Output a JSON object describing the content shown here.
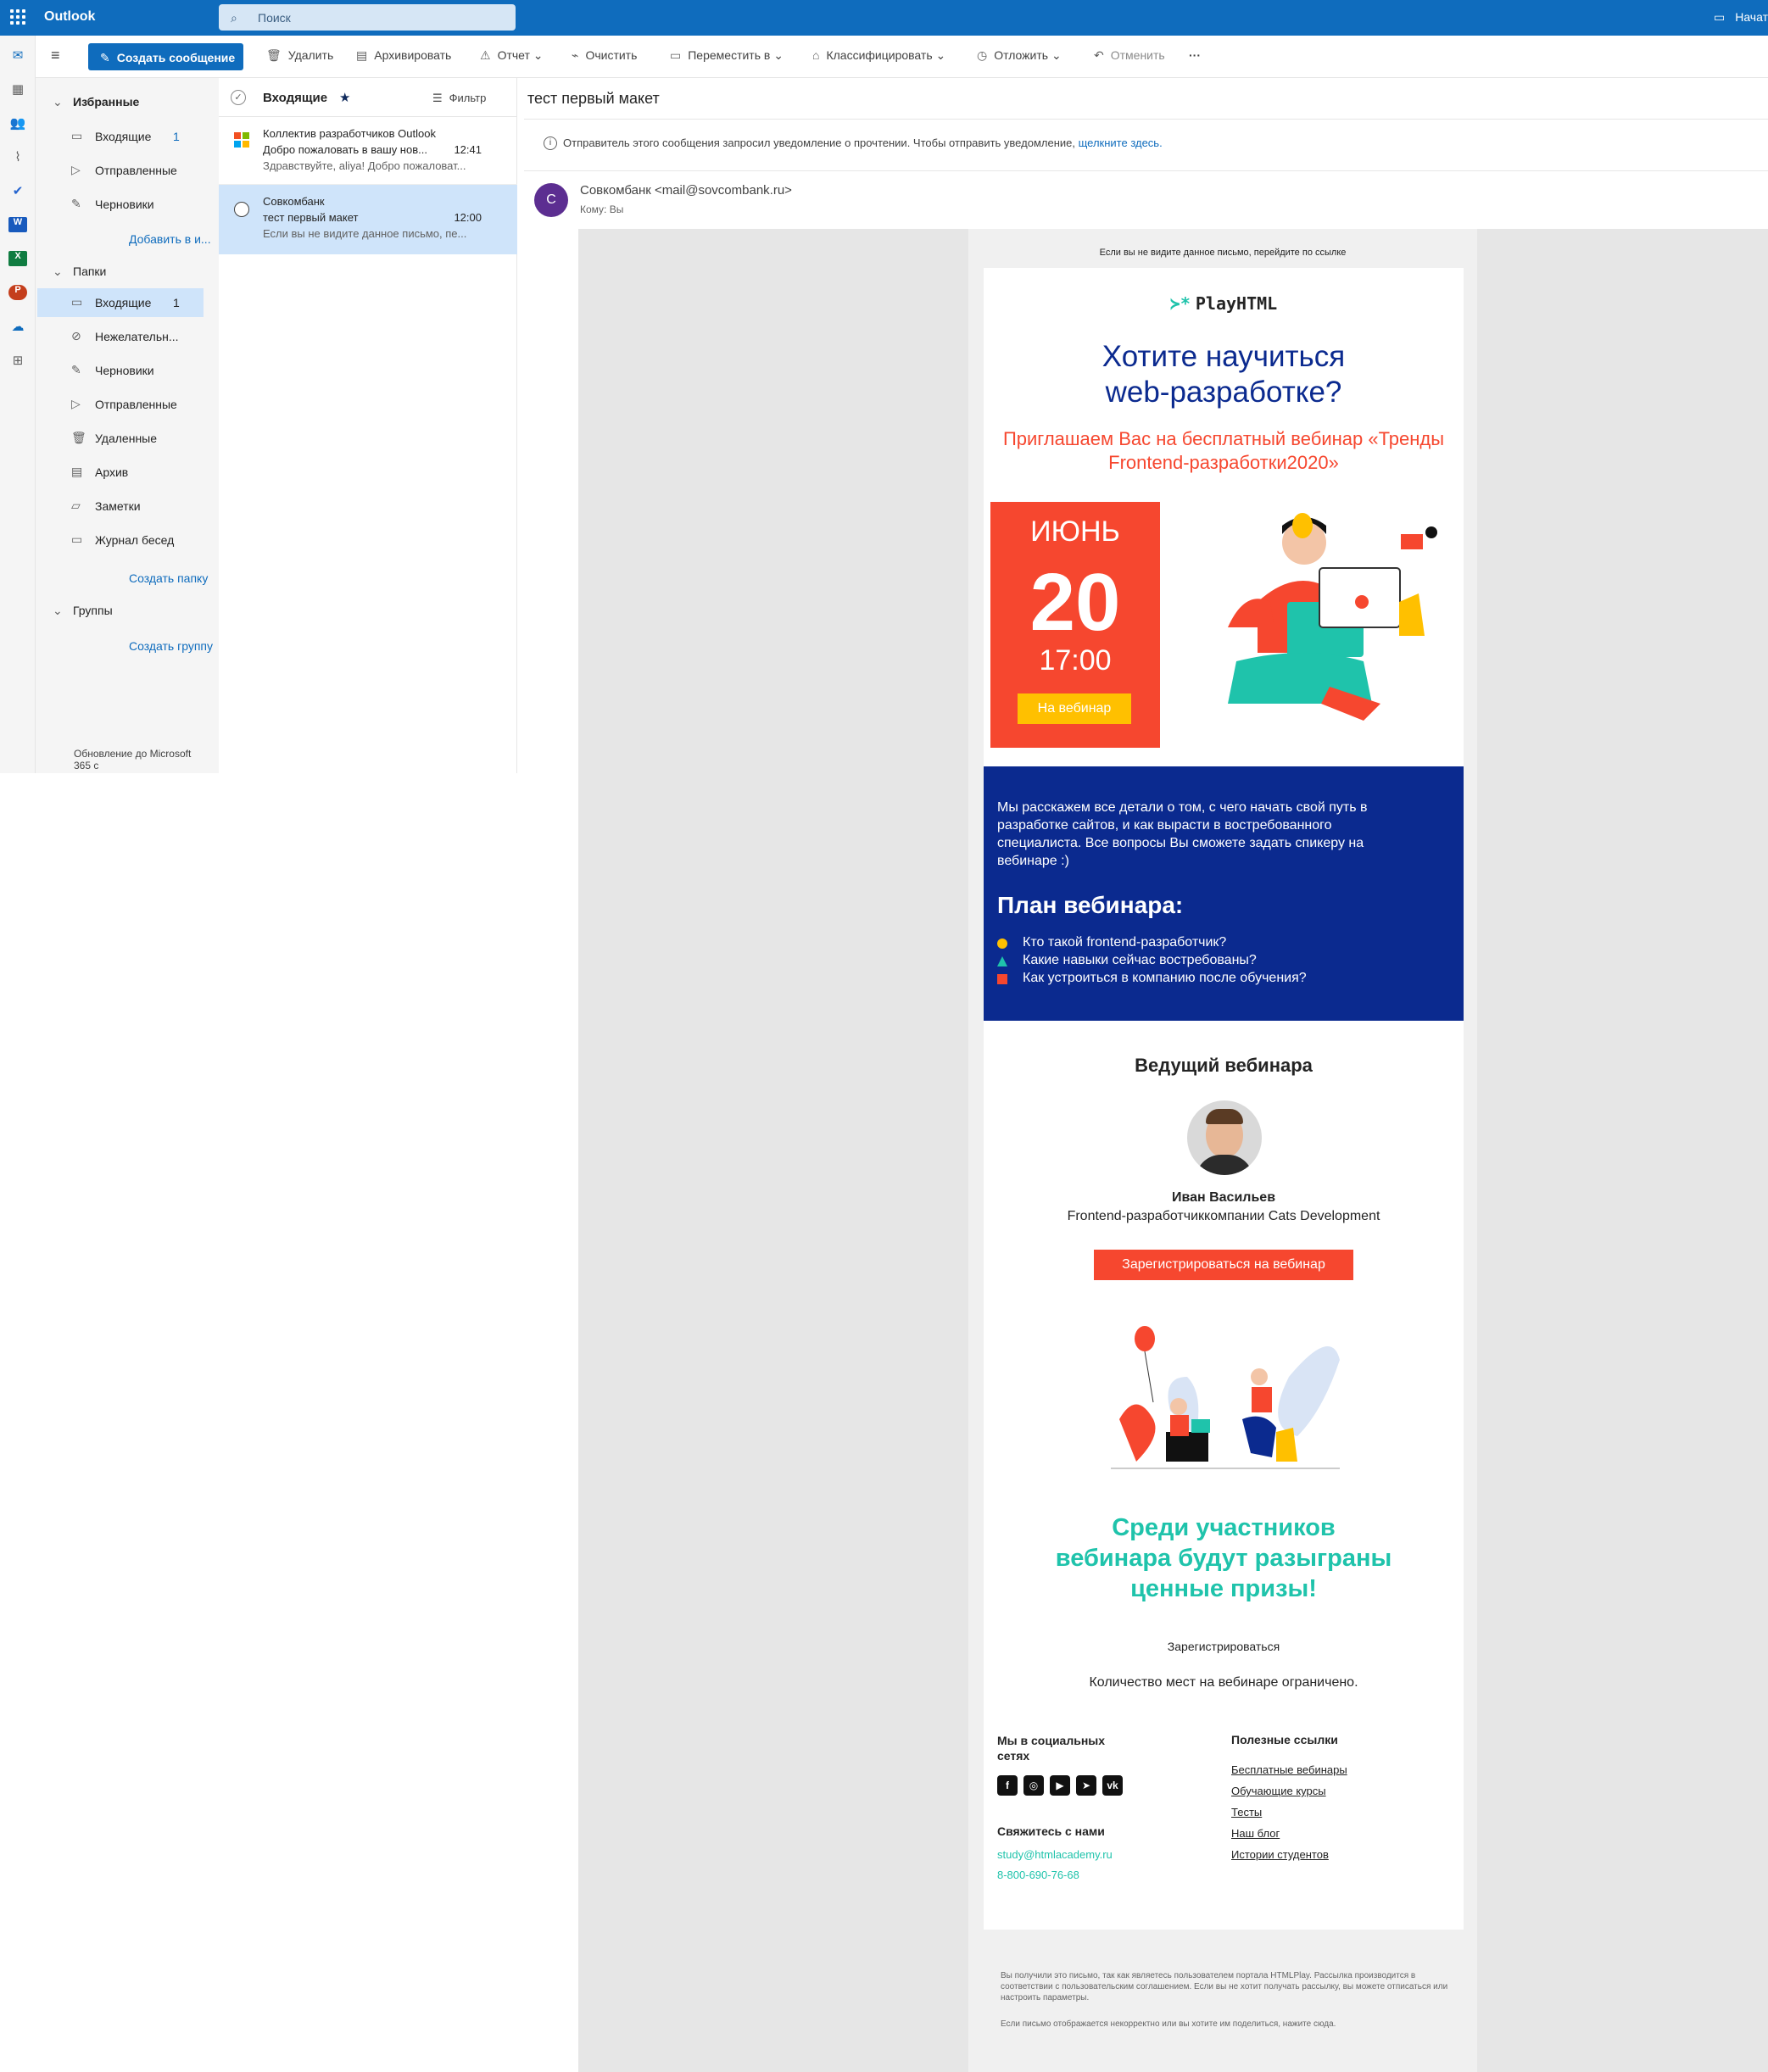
{
  "app": {
    "brand": "Outlook",
    "search_placeholder": "Поиск",
    "top_right": "Начат"
  },
  "toolbar": {
    "new_message": "Создать сообщение",
    "delete": "Удалить",
    "archive": "Архивировать",
    "report": "Отчет",
    "sweep": "Очистить",
    "move_to": "Переместить в",
    "categorize": "Классифицировать",
    "snooze": "Отложить",
    "undo": "Отменить",
    "more": "···"
  },
  "folders": {
    "favorites_header": "Избранные",
    "favorites": [
      {
        "label": "Входящие",
        "count": "1"
      },
      {
        "label": "Отправленные",
        "count": ""
      },
      {
        "label": "Черновики",
        "count": ""
      }
    ],
    "add_favorite": "Добавить в и...",
    "folders_header": "Папки",
    "items": [
      {
        "label": "Входящие",
        "count": "1"
      },
      {
        "label": "Нежелательн...",
        "count": ""
      },
      {
        "label": "Черновики",
        "count": ""
      },
      {
        "label": "Отправленные",
        "count": ""
      },
      {
        "label": "Удаленные",
        "count": ""
      },
      {
        "label": "Архив",
        "count": ""
      },
      {
        "label": "Заметки",
        "count": ""
      },
      {
        "label": "Журнал бесед",
        "count": ""
      }
    ],
    "create_folder": "Создать папку",
    "groups_header": "Группы",
    "create_group": "Создать группу",
    "upgrade": "Обновление до Microsoft 365 с"
  },
  "message_list": {
    "header": "Входящие",
    "filter": "Фильтр",
    "items": [
      {
        "sender": "Коллектив разработчиков Outlook",
        "subject": "Добро пожаловать в вашу нов...",
        "time": "12:41",
        "preview": "Здравствуйте, aliya! Добро пожаловат..."
      },
      {
        "sender": "Совкомбанк",
        "subject": "тест первый макет",
        "time": "12:00",
        "preview": "Если вы не видите данное письмо, пе..."
      }
    ]
  },
  "reading": {
    "subject": "тест первый макет",
    "notice": "Отправитель этого сообщения запросил уведомление о прочтении. Чтобы отправить уведомление,",
    "notice_link": "щелкните здесь.",
    "avatar_letter": "C",
    "sender": "Совкомбанк <mail@sovcombank.ru>",
    "to_label": "Кому:",
    "to_value": "Вы"
  },
  "email": {
    "preheader": "Если вы не видите данное письмо, перейдите по  ссылке",
    "logo": "PlayHTML",
    "headline": "Хотите научиться web-разработке?",
    "invite": "Приглашаем Вас на бесплатный вебинар «Тренды Frontend-разработки2020»",
    "month": "ИЮНЬ",
    "day": "20",
    "time": "17:00",
    "webinar_button": "На вебинар",
    "intro": "Мы расскажем все детали о том, с чего начать свой путь в разработке сайтов, и как вырасти в востребованного специалиста. Все вопросы Вы сможете задать спикеру на вебинаре :)",
    "plan_title": "План вебинара:",
    "plan": [
      "Кто такой frontend-разработчик?",
      "Какие навыки сейчас востребованы?",
      "Как устроиться в компанию после обучения?"
    ],
    "host_title": "Ведущий вебинара",
    "host_name": "Иван Васильев",
    "host_role": "Frontend-разработчиккомпании Cats Development",
    "register_button": "Зарегистрироваться на вебинар",
    "prizes": "Среди участников вебинара будут разыграны ценные призы!",
    "register_link": "Зарегистрироваться",
    "limited": "Количество мест на вебинаре ограничено.",
    "social_title": "Мы в социальных сетях",
    "contact_title": "Свяжитесь с нами",
    "email_address": "study@htmlacademy.ru",
    "phone": "8-800-690-76-68",
    "links_title": "Полезные ссылки",
    "links": [
      "Бесплатные вебинары",
      "Обучающие курсы",
      "Тесты",
      "Наш блог",
      "Истории студентов"
    ],
    "footer1": "Вы получили это письмо, так как являетесь пользователем портала HTMLPlay. Рассылка производится в соответствии с пользовательским соглашением. Если вы не хотит получать рассылку, вы можете отписаться или настроить параметры.",
    "footer2": "Если письмо отображается некорректно или вы хотите им поделиться, нажите сюда."
  },
  "colors": {
    "outlook_blue": "#0f6cbd",
    "email_navy": "#0b2a8f",
    "email_red": "#f6472f",
    "email_teal": "#1fc3ab",
    "email_yellow": "#ffc000"
  }
}
